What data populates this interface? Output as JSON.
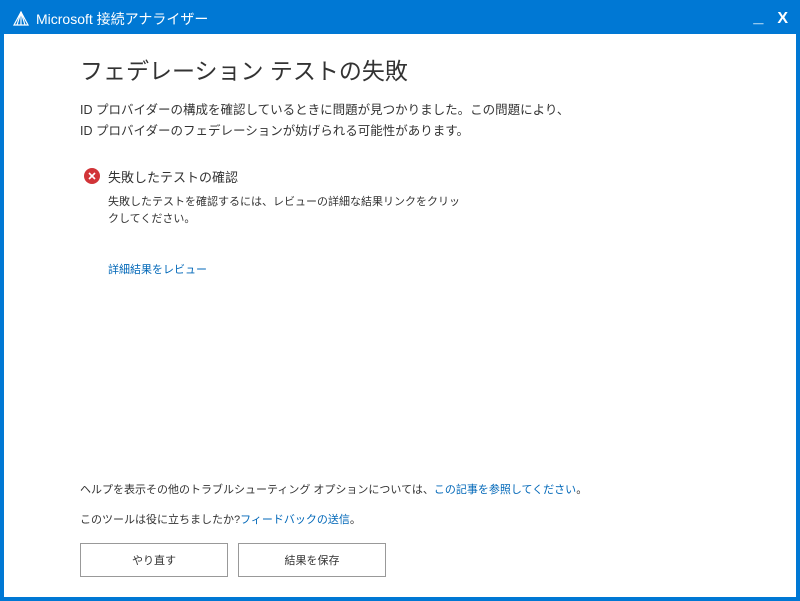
{
  "titlebar": {
    "app_name": "Microsoft 接続アナライザー"
  },
  "main": {
    "title": "フェデレーション テストの失敗",
    "description": "ID プロバイダーの構成を確認しているときに問題が見つかりました。この問題により、\nID プロバイダーのフェデレーションが妨げられる可能性があります。",
    "section_title": "失敗したテストの確認",
    "section_desc": "失敗したテストを確認するには、レビューの詳細な結果リンクをクリックしてください。",
    "details_link": "詳細結果をレビュー"
  },
  "footer": {
    "help_prefix": "ヘルプを表示その他のトラブルシューティング オプションについては、",
    "help_link": "この記事を参照してください",
    "help_suffix": "。",
    "feedback_prefix": "このツールは役に立ちましたか?",
    "feedback_link": "フィードバックの送信",
    "feedback_suffix": "。",
    "retry_button": "やり直す",
    "save_button": "結果を保存"
  }
}
